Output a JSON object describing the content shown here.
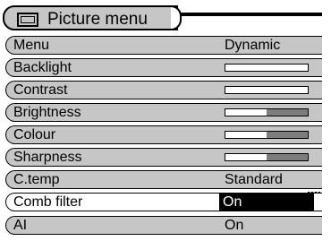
{
  "header": {
    "title": "Picture menu",
    "icon": "tv-screen-icon"
  },
  "rows": [
    {
      "label": "Menu",
      "value": "Dynamic"
    },
    {
      "label": "Backlight",
      "level": 1.0
    },
    {
      "label": "Contrast",
      "level": 1.0
    },
    {
      "label": "Brightness",
      "level": 0.5
    },
    {
      "label": "Colour",
      "level": 0.5
    },
    {
      "label": "Sharpness",
      "level": 0.5
    },
    {
      "label": "C.temp",
      "value": "Standard"
    },
    {
      "label": "Comb filter",
      "value": "On",
      "selected": true
    },
    {
      "label": "AI",
      "value": "On"
    }
  ],
  "colors": {
    "row_bg": "#c6c6c6",
    "bar_remaining": "#7d7d7d",
    "selected_bg": "#ffffff",
    "value_highlight": "#000000"
  }
}
